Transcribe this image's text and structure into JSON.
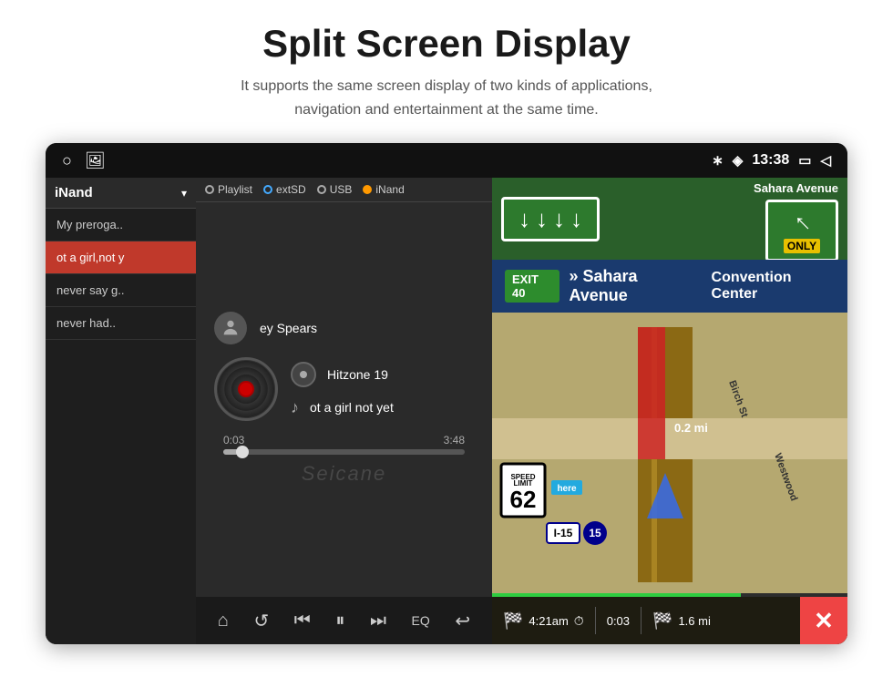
{
  "page": {
    "title": "Split Screen Display",
    "subtitle_line1": "It supports the same screen display of two kinds of applications,",
    "subtitle_line2": "navigation and entertainment at the same time."
  },
  "status_bar": {
    "bluetooth_icon": "bluetooth",
    "location_icon": "location",
    "time": "13:38",
    "window_icon": "window",
    "back_icon": "back"
  },
  "music": {
    "source_label": "iNand",
    "sources": [
      "Playlist",
      "extSD",
      "USB",
      "iNand"
    ],
    "playlist": [
      {
        "label": "My preroga..",
        "active": false
      },
      {
        "label": "ot a girl,not y",
        "active": true
      },
      {
        "label": "never say g..",
        "active": false
      },
      {
        "label": "never had..",
        "active": false
      }
    ],
    "artist": "ey Spears",
    "album": "Hitzone 19",
    "song": "ot a girl not yet",
    "progress_current": "0:03",
    "progress_total": "3:48",
    "watermark": "Seicane",
    "controls": [
      "home",
      "repeat",
      "prev",
      "pause",
      "next",
      "eq",
      "back"
    ]
  },
  "navigation": {
    "highway_arrows": [
      "↓",
      "↓",
      "↓",
      "↓"
    ],
    "only_label": "ONLY",
    "exit_number": "EXIT 40",
    "exit_street": "» Sahara Avenue",
    "exit_place": "Convention Center",
    "distance_top": "0.2 mi",
    "speed_limit_label": "LIMIT",
    "speed_limit": "62",
    "here_label": "here",
    "interstate_label": "I-15",
    "interstate_number": "15",
    "eta_time": "4:21am",
    "trip_elapsed": "0:03",
    "remaining_dist": "1.6 mi",
    "road_labels": [
      "Birch St",
      "Westwood"
    ]
  }
}
